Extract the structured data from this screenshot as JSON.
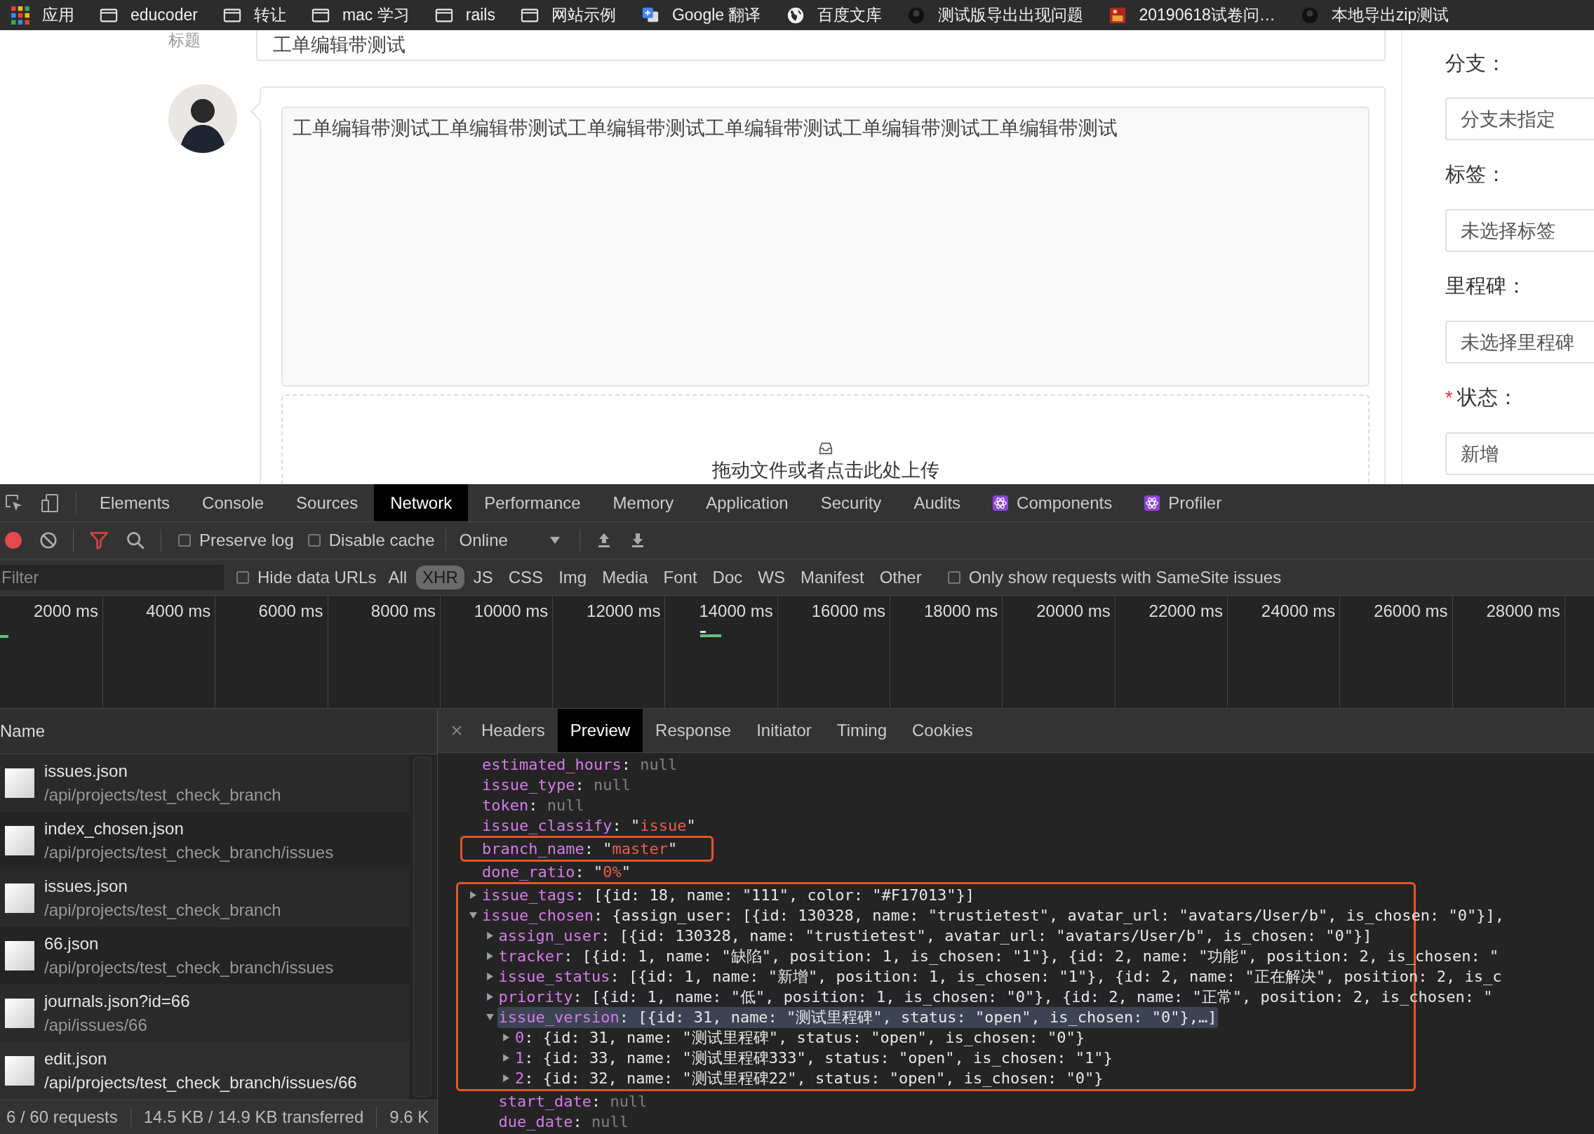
{
  "bookmarks": [
    {
      "kind": "apps",
      "label": "应用"
    },
    {
      "kind": "folder",
      "label": "educoder"
    },
    {
      "kind": "folder",
      "label": "转让"
    },
    {
      "kind": "folder",
      "label": "mac 学习"
    },
    {
      "kind": "folder",
      "label": "rails"
    },
    {
      "kind": "folder",
      "label": "网站示例"
    },
    {
      "kind": "translate",
      "label": "Google 翻译"
    },
    {
      "kind": "globe",
      "label": "百度文库"
    },
    {
      "kind": "circle",
      "label": "测试版导出出现问题"
    },
    {
      "kind": "image",
      "label": "20190618试卷问…"
    },
    {
      "kind": "circle",
      "label": "本地导出zip测试"
    }
  ],
  "issue_form": {
    "title_label": "标题",
    "title_value": "工单编辑带测试",
    "description": "工单编辑带测试工单编辑带测试工单编辑带测试工单编辑带测试工单编辑带测试工单编辑带测试",
    "upload_hint": "拖动文件或者点击此处上传"
  },
  "sidebar": {
    "fields": [
      {
        "label": "分支：",
        "value": "分支未指定"
      },
      {
        "label": "标签：",
        "value": "未选择标签"
      },
      {
        "label": "里程碑：",
        "value": "未选择里程碑"
      },
      {
        "required_mark": "*",
        "label": "状态：",
        "value": "新增"
      }
    ]
  },
  "devtools": {
    "tabs": [
      {
        "kind": "plain",
        "label": "Elements",
        "selected": false
      },
      {
        "kind": "plain",
        "label": "Console",
        "selected": false
      },
      {
        "kind": "plain",
        "label": "Sources",
        "selected": false
      },
      {
        "kind": "plain",
        "label": "Network",
        "selected": true
      },
      {
        "kind": "plain",
        "label": "Performance",
        "selected": false
      },
      {
        "kind": "plain",
        "label": "Memory",
        "selected": false
      },
      {
        "kind": "plain",
        "label": "Application",
        "selected": false
      },
      {
        "kind": "plain",
        "label": "Security",
        "selected": false
      },
      {
        "kind": "plain",
        "label": "Audits",
        "selected": false
      },
      {
        "kind": "react",
        "label": "Components",
        "selected": false
      },
      {
        "kind": "react",
        "label": "Profiler",
        "selected": false
      }
    ],
    "toolbar": {
      "preserve_log": {
        "label": "Preserve log",
        "checked": false
      },
      "disable_cache": {
        "label": "Disable cache",
        "checked": false
      },
      "throttling": "Online"
    },
    "filter_bar": {
      "placeholder": "Filter",
      "hide_data_urls": {
        "label": "Hide data URLs",
        "checked": false
      },
      "types": [
        {
          "label": "All",
          "selected": false
        },
        {
          "label": "XHR",
          "selected": true
        },
        {
          "label": "JS",
          "selected": false
        },
        {
          "label": "CSS",
          "selected": false
        },
        {
          "label": "Img",
          "selected": false
        },
        {
          "label": "Media",
          "selected": false
        },
        {
          "label": "Font",
          "selected": false
        },
        {
          "label": "Doc",
          "selected": false
        },
        {
          "label": "WS",
          "selected": false
        },
        {
          "label": "Manifest",
          "selected": false
        },
        {
          "label": "Other",
          "selected": false
        }
      ],
      "samesite": {
        "label": "Only show requests with SameSite issues",
        "checked": false
      }
    },
    "timeline": {
      "ticks": [
        "2000 ms",
        "4000 ms",
        "6000 ms",
        "8000 ms",
        "10000 ms",
        "12000 ms",
        "14000 ms",
        "16000 ms",
        "18000 ms",
        "20000 ms",
        "22000 ms",
        "24000 ms",
        "26000 ms",
        "28000 ms"
      ]
    },
    "requests": {
      "header": "Name",
      "rows": [
        {
          "name": "issues.json",
          "path": "/api/projects/test_check_branch",
          "selected": false
        },
        {
          "name": "index_chosen.json",
          "path": "/api/projects/test_check_branch/issues",
          "selected": false
        },
        {
          "name": "issues.json",
          "path": "/api/projects/test_check_branch",
          "selected": false
        },
        {
          "name": "66.json",
          "path": "/api/projects/test_check_branch/issues",
          "selected": false
        },
        {
          "name": "journals.json?id=66",
          "path": "/api/issues/66",
          "selected": false
        },
        {
          "name": "edit.json",
          "path": "/api/projects/test_check_branch/issues/66",
          "selected": true
        }
      ]
    },
    "summary": [
      "6 / 60 requests",
      "14.5 KB / 14.9 KB transferred",
      "9.6 K"
    ],
    "detail_tabs": [
      {
        "label": "Headers",
        "selected": false
      },
      {
        "label": "Preview",
        "selected": true
      },
      {
        "label": "Response",
        "selected": false
      },
      {
        "label": "Initiator",
        "selected": false
      },
      {
        "label": "Timing",
        "selected": false
      },
      {
        "label": "Cookies",
        "selected": false
      }
    ],
    "preview": {
      "items": [
        {
          "key": "estimated_hours:",
          "value": "null",
          "kind": "null",
          "selected": false
        },
        {
          "key": "issue_type:",
          "value": "null",
          "kind": "null",
          "selected": false
        },
        {
          "key": "token:",
          "value": "null",
          "kind": "null",
          "selected": false
        },
        {
          "key": "issue_classify:",
          "value": "\"issue\"",
          "kind": "string",
          "selected": false
        },
        {
          "key": "branch_name:",
          "value": "\"master\"",
          "kind": "string",
          "selected": false
        },
        {
          "key": "done_ratio:",
          "value": "\"0%\"",
          "kind": "string",
          "selected": false
        },
        {
          "key": "issue_tags:",
          "value": "[{id: 18, name: \"111\", color: \"#F17013\"}]",
          "kind": "preview",
          "expanded": false,
          "selected": false
        },
        {
          "key": "issue_chosen:",
          "value": "{assign_user: [{id: 130328, name: \"trustietest\", avatar_url: \"avatars/User/b\", is_chosen: \"0\"}],",
          "kind": "preview",
          "expanded": true,
          "selected": false,
          "children": [
            {
              "key": "assign_user:",
              "value": "[{id: 130328, name: \"trustietest\", avatar_url: \"avatars/User/b\", is_chosen: \"0\"}]",
              "kind": "preview",
              "expanded": false,
              "selected": false
            },
            {
              "key": "tracker:",
              "value": "[{id: 1, name: \"缺陷\", position: 1, is_chosen: \"1\"}, {id: 2, name: \"功能\", position: 2, is_chosen: \"",
              "kind": "preview",
              "expanded": false,
              "selected": false
            },
            {
              "key": "issue_status:",
              "value": "[{id: 1, name: \"新增\", position: 1, is_chosen: \"1\"}, {id: 2, name: \"正在解决\", position: 2, is_c",
              "kind": "preview",
              "expanded": false,
              "selected": false
            },
            {
              "key": "priority:",
              "value": "[{id: 1, name: \"低\", position: 1, is_chosen: \"0\"}, {id: 2, name: \"正常\", position: 2, is_chosen: \"",
              "kind": "preview",
              "expanded": false,
              "selected": false
            },
            {
              "key": "issue_version:",
              "value": "[{id: 31, name: \"测试里程碑\", status: \"open\", is_chosen: \"0\"},…]",
              "kind": "preview",
              "expanded": true,
              "selected": true,
              "children": [
                {
                  "key": "0:",
                  "value": "{id: 31, name: \"测试里程碑\", status: \"open\", is_chosen: \"0\"}",
                  "kind": "preview",
                  "expanded": false,
                  "selected": false
                },
                {
                  "key": "1:",
                  "value": "{id: 33, name: \"测试里程碑333\", status: \"open\", is_chosen: \"1\"}",
                  "kind": "preview",
                  "expanded": false,
                  "selected": false
                },
                {
                  "key": "2:",
                  "value": "{id: 32, name: \"测试里程碑22\", status: \"open\", is_chosen: \"0\"}",
                  "kind": "preview",
                  "expanded": false,
                  "selected": false
                }
              ]
            },
            {
              "key": "start_date:",
              "value": "null",
              "kind": "null",
              "selected": false
            },
            {
              "key": "due_date:",
              "value": "null",
              "kind": "null",
              "selected": false
            }
          ]
        }
      ]
    }
  }
}
